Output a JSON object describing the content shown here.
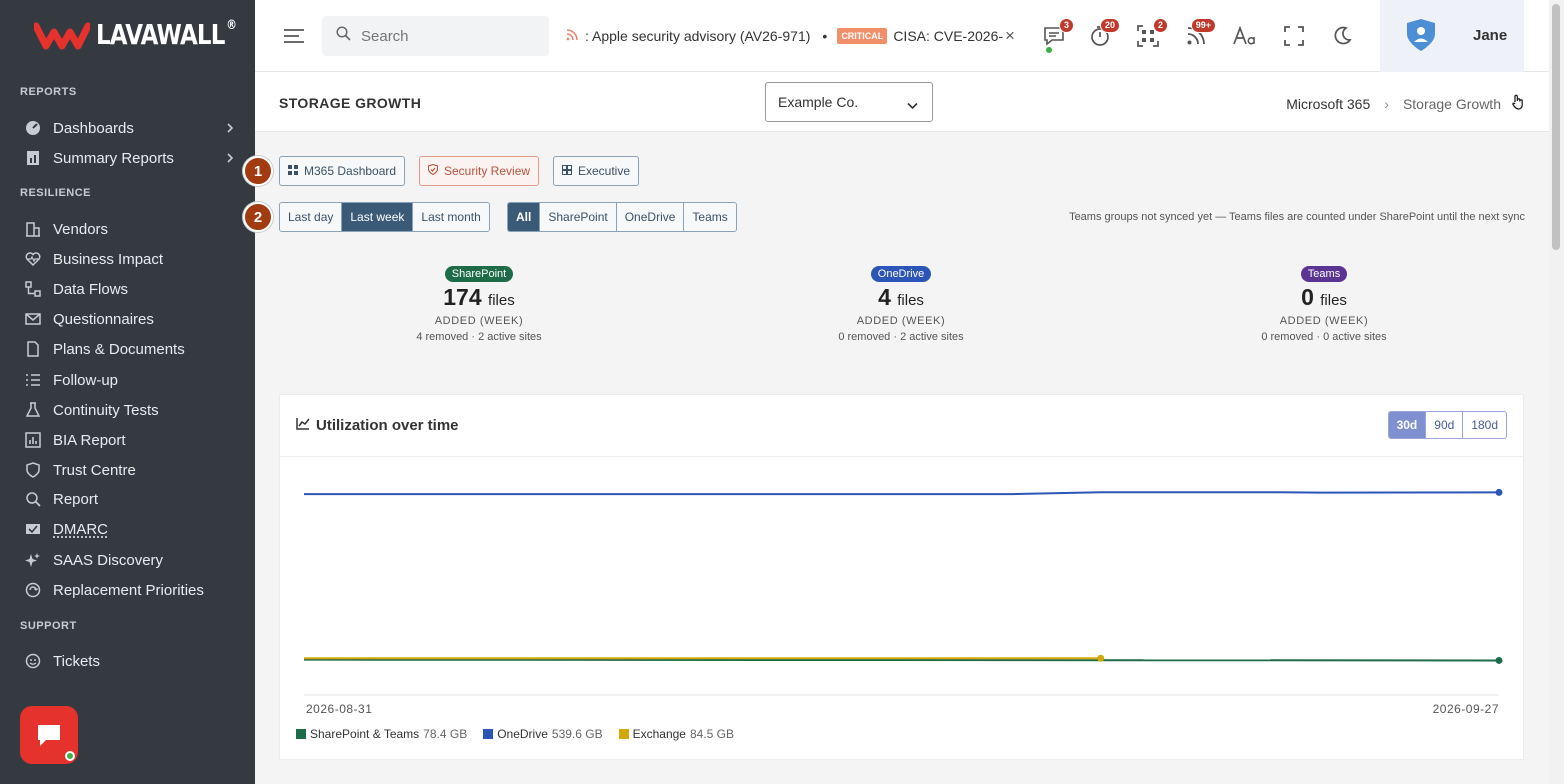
{
  "app": {
    "brand": "LAVAWALL",
    "brand_mark": "®"
  },
  "sidebar": {
    "sections": [
      {
        "label": "REPORTS"
      },
      {
        "label": "RESILIENCE"
      },
      {
        "label": "SUPPORT"
      }
    ],
    "items": [
      {
        "label": "Dashboards",
        "icon": "dashboard-gauge-icon",
        "has_children": true
      },
      {
        "label": "Summary Reports",
        "icon": "report-chart-icon",
        "has_children": true
      },
      {
        "label": "Vendors",
        "icon": "building-icon"
      },
      {
        "label": "Business Impact",
        "icon": "heart-pulse-icon"
      },
      {
        "label": "Data Flows",
        "icon": "flow-icon"
      },
      {
        "label": "Questionnaires",
        "icon": "envelope-icon"
      },
      {
        "label": "Plans & Documents",
        "icon": "document-icon"
      },
      {
        "label": "Follow-up",
        "icon": "list-icon"
      },
      {
        "label": "Continuity Tests",
        "icon": "flask-icon"
      },
      {
        "label": "BIA Report",
        "icon": "bar-chart-icon"
      },
      {
        "label": "Trust Centre",
        "icon": "shield-icon"
      },
      {
        "label": "Report",
        "icon": "magnifier-report-icon"
      },
      {
        "label": "DMARC",
        "icon": "mail-check-icon"
      },
      {
        "label": "SAAS Discovery",
        "icon": "sparkle-icon"
      },
      {
        "label": "Replacement Priorities",
        "icon": "cycle-icon"
      },
      {
        "label": "Tickets",
        "icon": "ticket-icon"
      }
    ]
  },
  "topbar": {
    "search_placeholder": "Search",
    "ticker_item_1": ": Apple security advisory (AV26-971)",
    "ticker_sep": "•",
    "ticker_badge": "CRITICAL",
    "ticker_item_2": "CISA: CVE-2026-",
    "ticker_close": "×",
    "badges": {
      "messages": "3",
      "alerts": "20",
      "scan": "2",
      "feeds": "99+"
    },
    "user_name": "Jane"
  },
  "page": {
    "title": "STORAGE GROWTH",
    "company_select": "Example Co.",
    "breadcrumb": [
      "Microsoft 365",
      "Storage Growth"
    ],
    "breadcrumb_sep": "›",
    "steps": [
      "1",
      "2"
    ],
    "quick_links": [
      {
        "label": "M365 Dashboard",
        "icon": "grid-icon"
      },
      {
        "label": "Security Review",
        "icon": "shield-check-icon"
      },
      {
        "label": "Executive",
        "icon": "layout-icon"
      }
    ],
    "period_tabs": [
      "Last day",
      "Last week",
      "Last month"
    ],
    "period_selected": "Last week",
    "source_tabs": [
      "All",
      "SharePoint",
      "OneDrive",
      "Teams"
    ],
    "source_selected": "All",
    "sync_note": "Teams groups not synced yet — Teams files are counted under SharePoint until the next sync",
    "cards": [
      {
        "pill": "SharePoint",
        "color": "#1e6b47",
        "count": "174",
        "unit": "files",
        "added": "ADDED (WEEK)",
        "sub": "4 removed · 2 active sites"
      },
      {
        "pill": "OneDrive",
        "color": "#2c55b8",
        "count": "4",
        "unit": "files",
        "added": "ADDED (WEEK)",
        "sub": "0 removed · 2 active sites"
      },
      {
        "pill": "Teams",
        "color": "#5a3593",
        "count": "0",
        "unit": "files",
        "added": "ADDED (WEEK)",
        "sub": "0 removed · 0 active sites"
      }
    ]
  },
  "panel": {
    "title": "Utilization over time",
    "ranges": [
      "30d",
      "90d",
      "180d"
    ],
    "range_selected": "30d"
  },
  "chart_data": {
    "type": "line",
    "x_start": "2026-08-31",
    "x_end": "2026-09-27",
    "tick_labels": [
      "2026-08-31",
      "2026-09-27"
    ],
    "ylim": [
      0,
      560
    ],
    "grid": false,
    "legend": "bottom-left",
    "series": [
      {
        "name": "SharePoint & Teams",
        "value_label": "78.4 GB",
        "color": "#1e6b47",
        "points": [
          [
            "2026-08-31",
            80.6
          ],
          [
            "2026-09-27",
            78.4
          ]
        ]
      },
      {
        "name": "OneDrive",
        "value_label": "539.6 GB",
        "color": "#2c55b8",
        "points": [
          [
            "2026-08-31",
            535
          ],
          [
            "2026-09-16",
            535
          ],
          [
            "2026-09-18",
            540
          ],
          [
            "2026-09-22",
            540
          ],
          [
            "2026-09-23",
            539
          ],
          [
            "2026-09-27",
            539.6
          ]
        ]
      },
      {
        "name": "Exchange",
        "value_label": "84.5 GB",
        "color": "#d4a80a",
        "points": [
          [
            "2026-08-31",
            84.5
          ],
          [
            "2026-09-18",
            84.5
          ]
        ]
      }
    ]
  }
}
